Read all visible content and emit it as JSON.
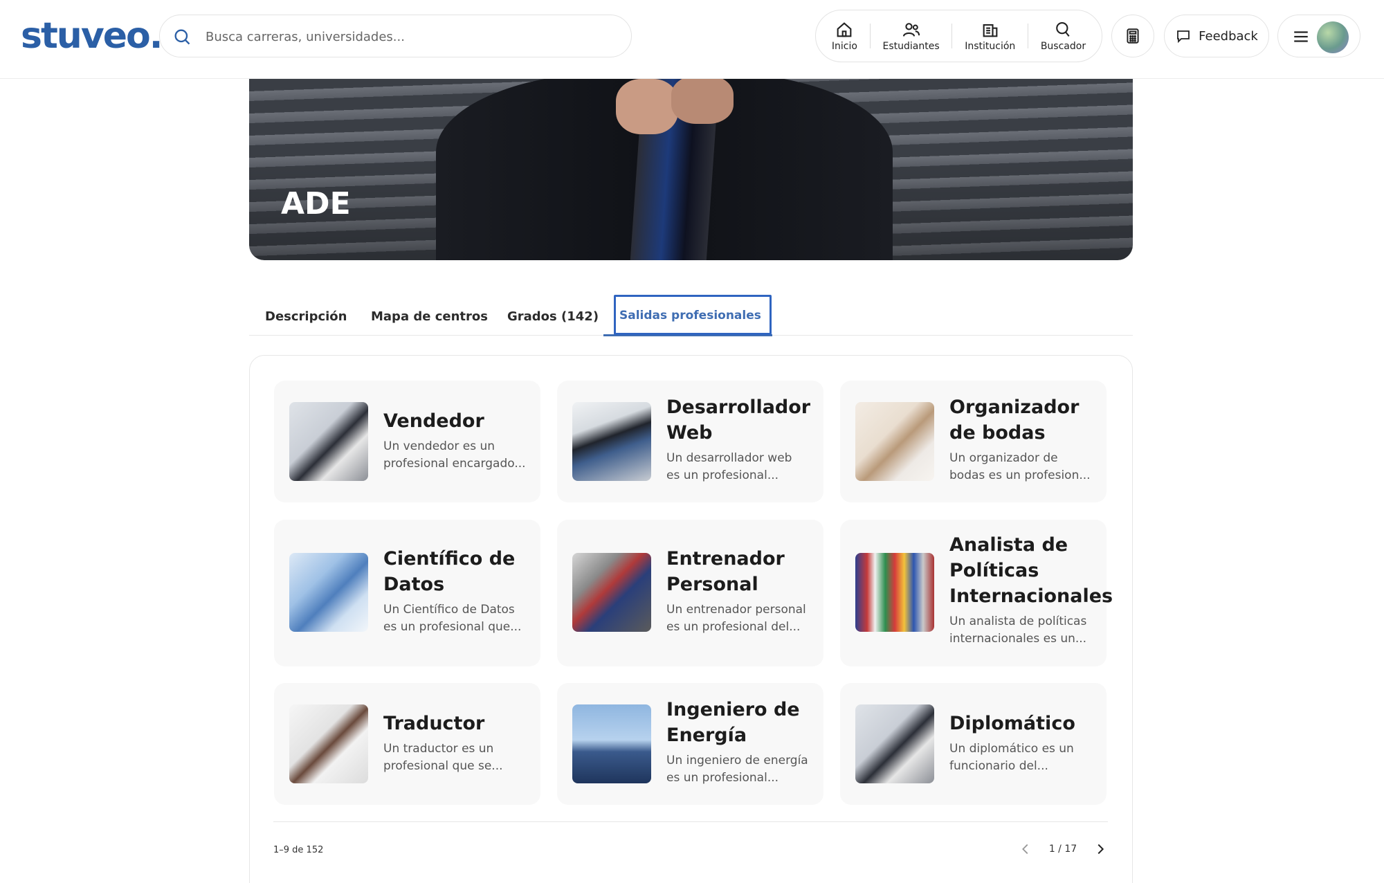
{
  "header": {
    "logo": "stuveo.",
    "search_placeholder": "Busca carreras, universidades...",
    "nav": [
      {
        "label": "Inicio",
        "icon": "home-icon"
      },
      {
        "label": "Estudiantes",
        "icon": "students-icon"
      },
      {
        "label": "Institución",
        "icon": "institution-icon"
      },
      {
        "label": "Buscador",
        "icon": "search-icon"
      }
    ],
    "feedback_label": "Feedback"
  },
  "hero": {
    "title": "ADE"
  },
  "tabs": [
    {
      "label": "Descripción"
    },
    {
      "label": "Mapa de centros"
    },
    {
      "label": "Grados (142)"
    },
    {
      "label": "Salidas profesionales",
      "active": true
    }
  ],
  "cards": [
    {
      "title": "Vendedor",
      "desc_1": "Un vendedor es un",
      "desc_2": "profesional encargado..."
    },
    {
      "title": "Desarrollador Web",
      "desc_1": "Un desarrollador web",
      "desc_2": "es un profesional..."
    },
    {
      "title": "Organizador de bodas",
      "desc_1": "Un organizador de",
      "desc_2": "bodas es un profesion..."
    },
    {
      "title": "Científico de Datos",
      "desc_1": "Un Científico de Datos",
      "desc_2": "es un profesional que..."
    },
    {
      "title": "Entrenador Personal",
      "desc_1": "Un entrenador personal",
      "desc_2": "es un profesional del..."
    },
    {
      "title": "Analista de Políticas Internacionales",
      "desc_1": "Un analista de políticas",
      "desc_2": "internacionales es un..."
    },
    {
      "title": "Traductor",
      "desc_1": "Un traductor es un",
      "desc_2": "profesional que se..."
    },
    {
      "title": "Ingeniero de Energía",
      "desc_1": "Un ingeniero de energía",
      "desc_2": "es un profesional..."
    },
    {
      "title": "Diplomático",
      "desc_1": "Un diplomático es un",
      "desc_2": "funcionario del..."
    }
  ],
  "footer": {
    "count": "1–9 de 152",
    "page": "1 / 17"
  }
}
